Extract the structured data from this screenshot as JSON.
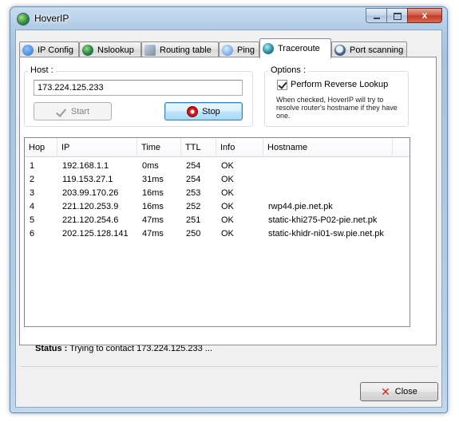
{
  "window": {
    "title": "HoverIP",
    "caption_buttons": {
      "minimize": "minimize",
      "maximize": "maximize",
      "close": "x"
    }
  },
  "tabs": [
    {
      "label": "IP Config",
      "icon": "info-icon",
      "color": "#2d6fc4"
    },
    {
      "label": "Nslookup",
      "icon": "globe-icon",
      "color": "#2b7d3c"
    },
    {
      "label": "Routing table",
      "icon": "network-icon",
      "color": "#7a8da3"
    },
    {
      "label": "Ping",
      "icon": "ping-icon",
      "color": "#4a8ad0"
    },
    {
      "label": "Traceroute",
      "icon": "globe-route-icon",
      "color": "#2b8a9a",
      "active": true
    },
    {
      "label": "Port scanning",
      "icon": "magnifier-icon",
      "color": "#6b87a8"
    }
  ],
  "host": {
    "label": "Host :",
    "value": "173.224.125.233",
    "start_label": "Start",
    "stop_label": "Stop"
  },
  "options": {
    "label": "Options :",
    "reverse_lookup_label": "Perform Reverse Lookup",
    "reverse_lookup_checked": true,
    "hint": "When checked, HoverIP will try to resolve router's hostname if they have one."
  },
  "table": {
    "columns": [
      "Hop",
      "IP",
      "Time",
      "TTL",
      "Info",
      "Hostname"
    ],
    "rows": [
      [
        "1",
        "192.168.1.1",
        "0ms",
        "254",
        "OK",
        ""
      ],
      [
        "2",
        "119.153.27.1",
        "31ms",
        "254",
        "OK",
        ""
      ],
      [
        "3",
        "203.99.170.26",
        "16ms",
        "253",
        "OK",
        ""
      ],
      [
        "4",
        "221.120.253.9",
        "16ms",
        "252",
        "OK",
        "rwp44.pie.net.pk"
      ],
      [
        "5",
        "221.120.254.6",
        "47ms",
        "251",
        "OK",
        "static-khi275-P02-pie.net.pk"
      ],
      [
        "6",
        "202.125.128.141",
        "47ms",
        "250",
        "OK",
        "static-khidr-ni01-sw.pie.net.pk"
      ]
    ]
  },
  "status": {
    "label": "Status :",
    "text": "Trying to contact 173.224.125.233 ..."
  },
  "footer": {
    "close_label": "Close"
  }
}
